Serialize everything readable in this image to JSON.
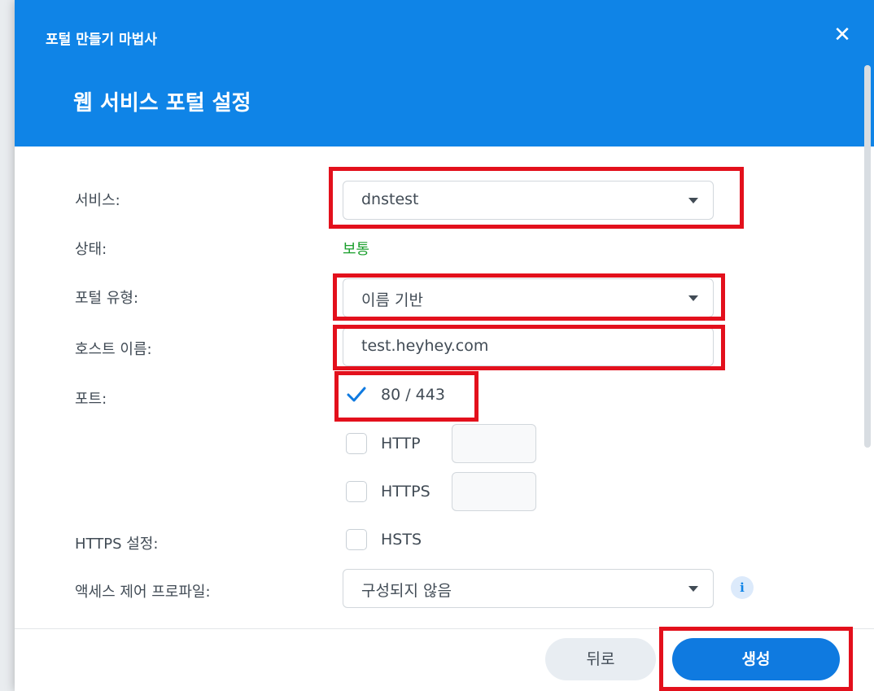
{
  "dialog": {
    "title": "포털 만들기 마법사",
    "heading": "웹 서비스 포털 설정",
    "close_label": "✕"
  },
  "form": {
    "service": {
      "label": "서비스:",
      "value": "dnstest"
    },
    "status": {
      "label": "상태:",
      "value": "보통",
      "color": "#1a9f2c"
    },
    "portal_type": {
      "label": "포털 유형:",
      "value": "이름 기반"
    },
    "hostname": {
      "label": "호스트 이름:",
      "value": "test.heyhey.com"
    },
    "port": {
      "label": "포트:",
      "options": [
        {
          "label": "80 / 443",
          "checked": true
        },
        {
          "label": "HTTP",
          "checked": false
        },
        {
          "label": "HTTPS",
          "checked": false
        }
      ]
    },
    "https_settings": {
      "label": "HTTPS 설정:",
      "hsts": {
        "label": "HSTS",
        "checked": false
      }
    },
    "access_profile": {
      "label": "액세스 제어 프로파일:",
      "value": "구성되지 않음",
      "info_icon": "i"
    }
  },
  "footer": {
    "back_label": "뒤로",
    "create_label": "생성"
  },
  "colors": {
    "header": "#0f84e7",
    "primary_button": "#0f7ae0",
    "highlight": "#e3101c"
  }
}
